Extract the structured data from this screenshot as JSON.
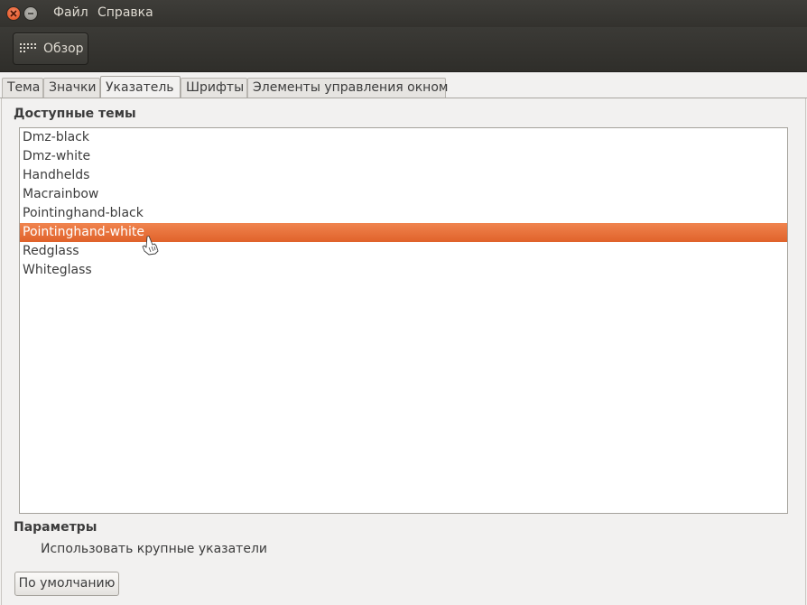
{
  "menubar": {
    "file": "Файл",
    "help": "Справка"
  },
  "toolbar": {
    "overview_label": "Обзор"
  },
  "tabs": [
    {
      "label": "Тема",
      "active": false
    },
    {
      "label": "Значки",
      "active": false
    },
    {
      "label": "Указатель",
      "active": true
    },
    {
      "label": "Шрифты",
      "active": false
    },
    {
      "label": "Элементы управления окном",
      "active": false
    }
  ],
  "themes": {
    "title": "Доступные темы",
    "items": [
      "Dmz-black",
      "Dmz-white",
      "Handhelds",
      "Macrainbow",
      "Pointinghand-black",
      "Pointinghand-white",
      "Redglass",
      "Whiteglass"
    ],
    "selected": "Pointinghand-white"
  },
  "params": {
    "title": "Параметры",
    "large_cursors_label": "Использовать крупные указатели"
  },
  "default_button": "По умолчанию",
  "colors": {
    "accent": "#e9703a",
    "titlebar": "#3c3b37",
    "background": "#f2f1f0"
  }
}
